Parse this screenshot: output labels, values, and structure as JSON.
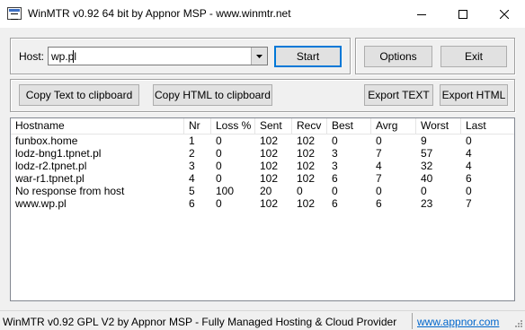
{
  "window": {
    "title": "WinMTR v0.92 64 bit by Appnor MSP - www.winmtr.net"
  },
  "host": {
    "label": "Host:",
    "value": "wp.pl"
  },
  "buttons": {
    "start": "Start",
    "options": "Options",
    "exit": "Exit",
    "copy_text": "Copy Text to clipboard",
    "copy_html": "Copy HTML to clipboard",
    "export_text": "Export TEXT",
    "export_html": "Export HTML"
  },
  "table": {
    "columns": [
      "Hostname",
      "Nr",
      "Loss %",
      "Sent",
      "Recv",
      "Best",
      "Avrg",
      "Worst",
      "Last"
    ],
    "rows": [
      [
        "funbox.home",
        "1",
        "0",
        "102",
        "102",
        "0",
        "0",
        "9",
        "0"
      ],
      [
        "lodz-bng1.tpnet.pl",
        "2",
        "0",
        "102",
        "102",
        "3",
        "7",
        "57",
        "4"
      ],
      [
        "lodz-r2.tpnet.pl",
        "3",
        "0",
        "102",
        "102",
        "3",
        "4",
        "32",
        "4"
      ],
      [
        "war-r1.tpnet.pl",
        "4",
        "0",
        "102",
        "102",
        "6",
        "7",
        "40",
        "6"
      ],
      [
        "No response from host",
        "5",
        "100",
        "20",
        "0",
        "0",
        "0",
        "0",
        "0"
      ],
      [
        "www.wp.pl",
        "6",
        "0",
        "102",
        "102",
        "6",
        "6",
        "23",
        "7"
      ]
    ]
  },
  "status": {
    "text": "WinMTR v0.92 GPL V2 by Appnor MSP - Fully Managed Hosting & Cloud Provider",
    "link": "www.appnor.com"
  }
}
